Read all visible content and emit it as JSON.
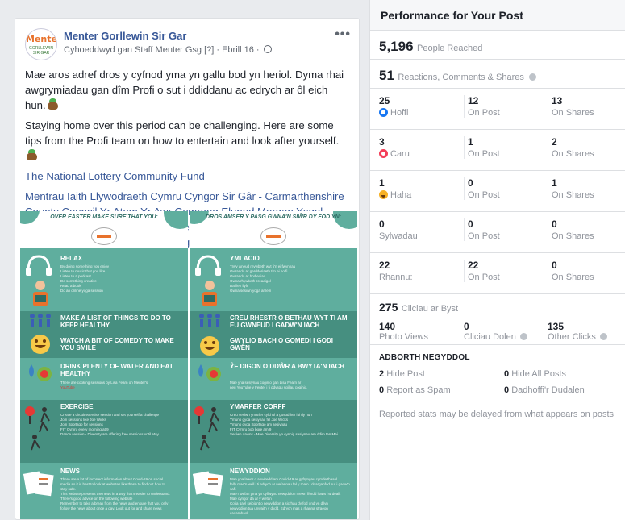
{
  "post": {
    "avatar": {
      "line1": "Menter",
      "line2": "GORLLEWIN SIR GAR"
    },
    "page_name": "Menter Gorllewin Sir Gar",
    "meta_author": "Cyhoeddwyd gan Staff Menter Gsg",
    "meta_ref": "[?]",
    "meta_date": "· Ebrill 16 ·",
    "more": "•••",
    "text_cy": "Mae aros adref dros y cyfnod yma yn gallu bod yn heriol. Dyma rhai awgrymiadau gan dîm Profi o sut i ddiddanu ac edrych ar ôl eich hun.",
    "text_en": "Staying home over this period can be challenging. Here are some tips from the Profi team on how to entertain and look after yourself.",
    "fund_link": "The National Lottery Community Fund",
    "tags": "Mentrau Iaith Llywodraeth Cymru Cyngor Sir Gâr - Carmarthenshire County Council Yr Atom Yr Awr Gymraeg Eluned Morgan Ysgol Gyfun Gymraeg Bro Myrddin Queen Elizabeth High School Ysgol Dyffryn Taf Ysgol Gyfun Emlyn Ysgol Bro Teifi Ysgol Bro Pedr"
  },
  "infographic_en": {
    "caption": "OVER EASTER MAKE SURE THAT YOU:",
    "sections": [
      {
        "title": "RELAX",
        "lines": [
          "By doing something you enjoy",
          "Listen to music that you like",
          "Listen to a podcast",
          "Do something creative",
          "Read a book",
          "Do an online yoga session"
        ]
      },
      {
        "title": "MAKE A LIST OF THINGS TO DO TO KEEP HEALTHY",
        "lines": []
      },
      {
        "title": "WATCH A BIT OF COMEDY TO MAKE YOU SMILE",
        "lines": []
      },
      {
        "title": "DRINK PLENTY OF WATER AND EAT HEALTHY",
        "lines": [
          "There are cooking sessions by Lisa Fearn on Menter's",
          "YouTube"
        ]
      },
      {
        "title": "EXERCISE",
        "lines": [
          "Create a circuit exercise session and set yourself a challenge",
          "Join sessions like Joe Wicks",
          "Join Sportsgo for sessions",
          "FIT Cymru every morning at 9",
          "Dance session - Diversity are offering free sessions until May"
        ]
      },
      {
        "title": "NEWS",
        "lines": [
          "There are a lot of incorrect information about Covid-19 on social",
          "media so it is best to look at websites like these to find out how to",
          "stay safe.",
          "This website presents the news in a way that's easier to understand.",
          "There's good advice on the following website",
          "Remember to take a break from the news and ensure that you only",
          "follow the news about once a day. Look out for and share news"
        ]
      }
    ]
  },
  "infographic_cy": {
    "caption": "DROS AMSER Y PASG GWNA'N SIŴR DY FOD YN:",
    "sections": [
      {
        "title": "YMLACIO",
        "lines": [
          "Trwy wneud rhywbeth wyt ti'n ei fwynhau",
          "Gwrando ar gerddoriaeth ti'n ei hoffi",
          "Gwrando ar bodlediad",
          "Gwna rhywbeth creadigol",
          "Darllen llyfr",
          "Gwna sesiwn yoga ar lein"
        ]
      },
      {
        "title": "CREU RHESTR O BETHAU WYT TI AM EU GWNEUD I GADW'N IACH",
        "lines": []
      },
      {
        "title": "GWYLIO BACH O GOMEDI I GODI GWÊN",
        "lines": []
      },
      {
        "title": "ŶF DIGON O DDŴR A BWYTA'N IACH",
        "lines": [
          "Mae yna sesiynau coginio gan Lisa Fearn ar",
          "neu YouTube y Fenter i ti ddysgu sgiliau coginio."
        ]
      },
      {
        "title": "YMARFER CORFF",
        "lines": [
          "Creu sesiwn ymarfer cylchol a gosod her i ti dy hun",
          "Ymuno gyda sesiynau fel Joe Wicks",
          "Ymuno gyda Sportsgo am sesiynau",
          "FIT Cymru bob bore am 9",
          "Sesiwn dawns - Mae Diversity yn cynnig sesiynau am ddim tan Mai"
        ]
      },
      {
        "title": "NEWYDDION",
        "lines": [
          "Mae yna lawer o anwiredd am Covid-19 ar gyfryngau cymdeithasol",
          "felly mae'n well i ti edrych ar wefannau fel y rhain i ddarganfod sut i gadw'n saff.",
          "Mae'r wefan yma yn cyflwyno newyddion mewn ffordd haws i'w deall.",
          "Mae cyngor da ar y wefan",
          "Cofia gael seibiant o newyddion a sicrhau dy fod ond yn dilyn",
          "newyddion tua unwaith y dydd. Edrych mas a rhanna straeon",
          "cadarnhaol."
        ]
      }
    ]
  },
  "performance": {
    "title": "Performance for Your Post",
    "people_reached_value": "5,196",
    "people_reached_label": "People Reached",
    "engagement_value": "51",
    "engagement_label": "Reactions, Comments & Shares",
    "rows": [
      {
        "total": "25",
        "label": "Hoffi",
        "emoji": "like-icon",
        "on_post": "12",
        "on_post_label": "On Post",
        "on_shares": "13",
        "on_shares_label": "On Shares"
      },
      {
        "total": "3",
        "label": "Caru",
        "emoji": "love-icon",
        "on_post": "1",
        "on_post_label": "On Post",
        "on_shares": "2",
        "on_shares_label": "On Shares"
      },
      {
        "total": "1",
        "label": "Haha",
        "emoji": "haha-icon",
        "on_post": "0",
        "on_post_label": "On Post",
        "on_shares": "1",
        "on_shares_label": "On Shares"
      },
      {
        "total": "0",
        "label": "Sylwadau",
        "emoji": "",
        "on_post": "0",
        "on_post_label": "On Post",
        "on_shares": "0",
        "on_shares_label": "On Shares"
      },
      {
        "total": "22",
        "label": "Rhannu:",
        "emoji": "",
        "on_post": "22",
        "on_post_label": "On Post",
        "on_shares": "0",
        "on_shares_label": "On Shares"
      }
    ],
    "clicks_value": "275",
    "clicks_label": "Cliciau ar Byst",
    "photo_views_value": "140",
    "photo_views_label": "Photo Views",
    "link_clicks_value": "0",
    "link_clicks_label": "Cliciau Dolen",
    "other_clicks_value": "135",
    "other_clicks_label": "Other Clicks",
    "negative_header": "ADBORTH NEGYDDOL",
    "hide_post_value": "2",
    "hide_post_label": "Hide Post",
    "hide_all_value": "0",
    "hide_all_label": "Hide All Posts",
    "report_spam_value": "0",
    "report_spam_label": "Report as Spam",
    "unlike_value": "0",
    "unlike_label": "Dadhoffi'r Dudalen",
    "disclaimer": "Reported stats may be delayed from what appears on posts"
  }
}
